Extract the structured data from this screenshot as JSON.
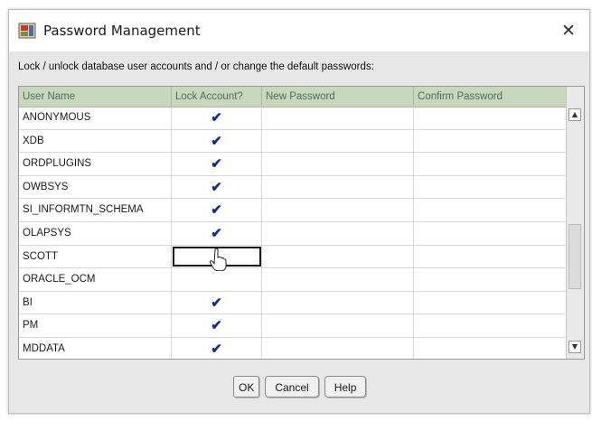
{
  "dialog": {
    "title": "Password Management",
    "close_glyph": "✕",
    "instruction": "Lock / unlock database user accounts and / or change the default passwords:"
  },
  "table": {
    "columns": [
      "User Name",
      "Lock Account?",
      "New Password",
      "Confirm Password"
    ],
    "rows": [
      {
        "user": "ANONYMOUS",
        "locked": true
      },
      {
        "user": "XDB",
        "locked": true
      },
      {
        "user": "ORDPLUGINS",
        "locked": true
      },
      {
        "user": "OWBSYS",
        "locked": true
      },
      {
        "user": "SI_INFORMTN_SCHEMA",
        "locked": true
      },
      {
        "user": "OLAPSYS",
        "locked": true
      },
      {
        "user": "SCOTT",
        "locked": false
      },
      {
        "user": "ORACLE_OCM",
        "locked": false
      },
      {
        "user": "BI",
        "locked": true
      },
      {
        "user": "PM",
        "locked": true
      },
      {
        "user": "MDDATA",
        "locked": true
      }
    ],
    "check_glyph": "✔"
  },
  "buttons": {
    "ok": "OK",
    "cancel": "Cancel",
    "help": "Help"
  },
  "icons": {
    "app": "oracle-installer-icon",
    "close": "close-icon",
    "check": "checkmark-icon",
    "cursor": "hand-cursor-icon"
  },
  "colors": {
    "header_bg": "#c9d7bd",
    "header_text": "#4c6e5a",
    "check": "#1a2a8c"
  }
}
